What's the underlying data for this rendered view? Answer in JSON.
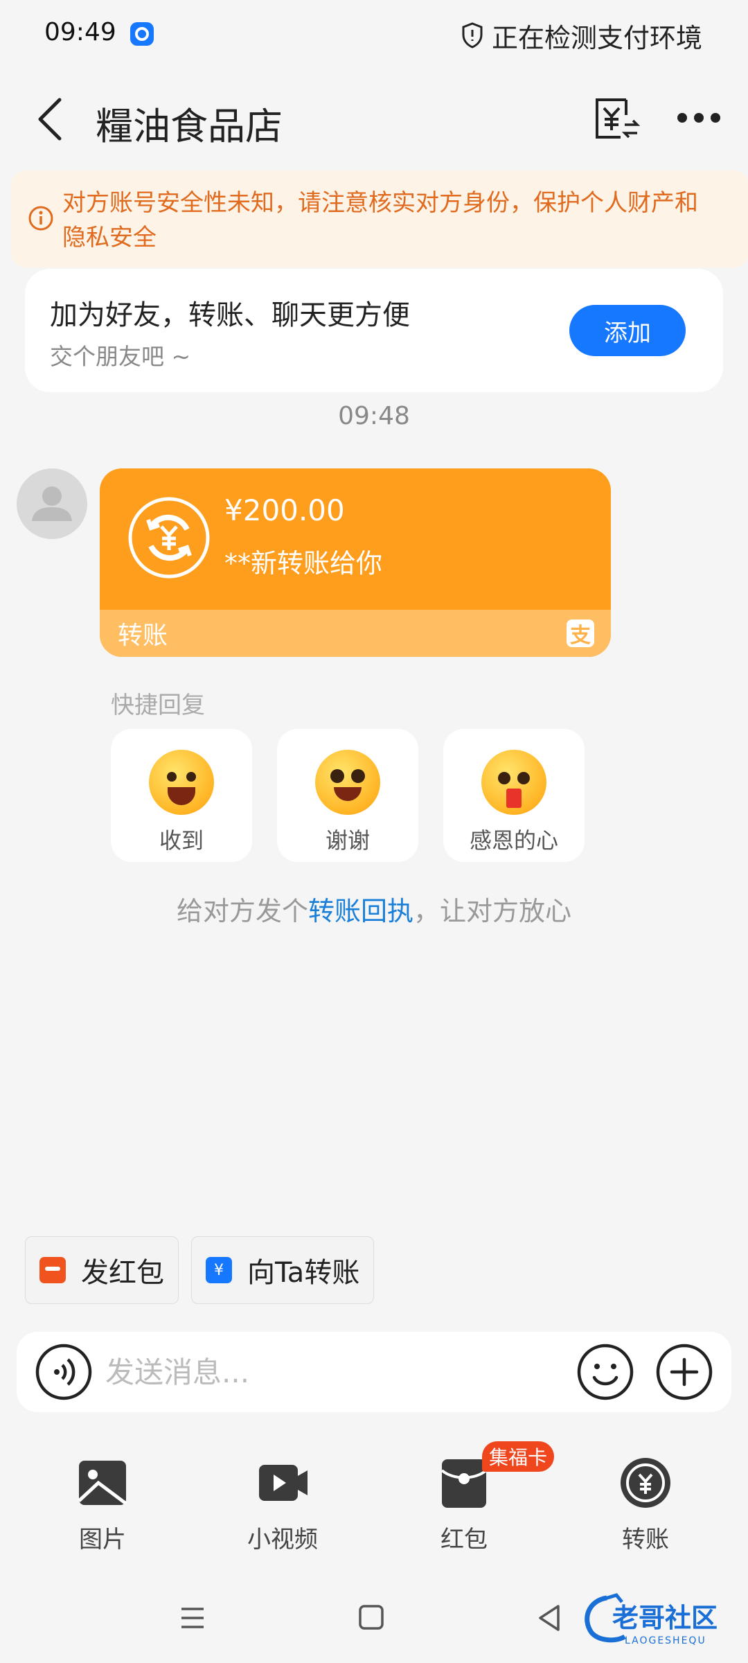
{
  "status_bar": {
    "time": "09:49",
    "status_text": "正在检测支付环境"
  },
  "header": {
    "title": "糧油食品店"
  },
  "warning": {
    "text": "对方账号安全性未知，请注意核实对方身份，保护个人财产和隐私安全"
  },
  "friend_card": {
    "title": "加为好友，转账、聊天更方便",
    "subtitle": "交个朋友吧 ~",
    "add_label": "添加"
  },
  "chat": {
    "timestamp": "09:48",
    "message": {
      "amount": "¥200.00",
      "note": "**新转账给你",
      "label": "转账"
    }
  },
  "quick_reply": {
    "title": "快捷回复",
    "items": [
      {
        "label": "收到"
      },
      {
        "label": "谢谢"
      },
      {
        "label": "感恩的心"
      }
    ]
  },
  "receipt_hint": {
    "prefix": "给对方发个",
    "link": "转账回执",
    "suffix": "，让对方放心"
  },
  "shortcuts": {
    "red_packet": "发红包",
    "transfer": "向Ta转账"
  },
  "input": {
    "placeholder": "发送消息..."
  },
  "panel": {
    "items": [
      {
        "label": "图片",
        "icon": "image-icon"
      },
      {
        "label": "小视频",
        "icon": "video-icon"
      },
      {
        "label": "红包",
        "icon": "red-packet-icon"
      },
      {
        "label": "转账",
        "icon": "transfer-icon"
      }
    ],
    "badge": "集福卡"
  },
  "watermark": {
    "title": "老哥社区",
    "subtitle": "LAOGESHEQU"
  },
  "colors": {
    "accent_blue": "#1677ff",
    "transfer_orange": "#ff9d1c",
    "warning_text": "#e06a1e",
    "badge_red": "#f0461e"
  }
}
